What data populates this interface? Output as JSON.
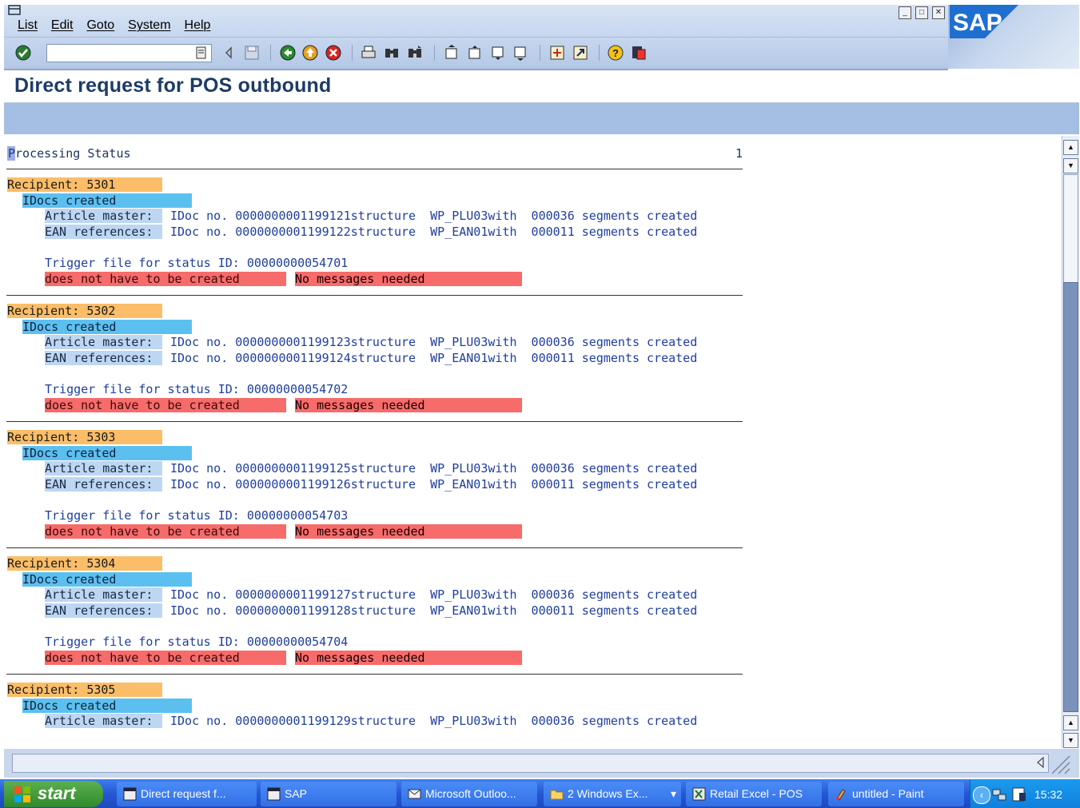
{
  "menu": {
    "items": [
      "List",
      "Edit",
      "Goto",
      "System",
      "Help"
    ]
  },
  "brand": "SAP",
  "command_field": {
    "value": ""
  },
  "title": "Direct request for POS outbound",
  "report": {
    "header": "Processing Status",
    "page": "1",
    "recipients": [
      {
        "label": "Recipient: 5301",
        "idocs": "IDocs created",
        "lines": [
          {
            "label": "Article master:",
            "text": "IDoc no. 0000000001199121structure  WP_PLU03with  000036 segments created"
          },
          {
            "label": "EAN references:",
            "text": "IDoc no. 0000000001199122structure  WP_EAN01with  000011 segments created"
          }
        ],
        "trigger": "Trigger file for status ID: 00000000054701",
        "status1": "does not have to be created",
        "status2": "No messages needed"
      },
      {
        "label": "Recipient: 5302",
        "idocs": "IDocs created",
        "lines": [
          {
            "label": "Article master:",
            "text": "IDoc no. 0000000001199123structure  WP_PLU03with  000036 segments created"
          },
          {
            "label": "EAN references:",
            "text": "IDoc no. 0000000001199124structure  WP_EAN01with  000011 segments created"
          }
        ],
        "trigger": "Trigger file for status ID: 00000000054702",
        "status1": "does not have to be created",
        "status2": "No messages needed"
      },
      {
        "label": "Recipient: 5303",
        "idocs": "IDocs created",
        "lines": [
          {
            "label": "Article master:",
            "text": "IDoc no. 0000000001199125structure  WP_PLU03with  000036 segments created"
          },
          {
            "label": "EAN references:",
            "text": "IDoc no. 0000000001199126structure  WP_EAN01with  000011 segments created"
          }
        ],
        "trigger": "Trigger file for status ID: 00000000054703",
        "status1": "does not have to be created",
        "status2": "No messages needed"
      },
      {
        "label": "Recipient: 5304",
        "idocs": "IDocs created",
        "lines": [
          {
            "label": "Article master:",
            "text": "IDoc no. 0000000001199127structure  WP_PLU03with  000036 segments created"
          },
          {
            "label": "EAN references:",
            "text": "IDoc no. 0000000001199128structure  WP_EAN01with  000011 segments created"
          }
        ],
        "trigger": "Trigger file for status ID: 00000000054704",
        "status1": "does not have to be created",
        "status2": "No messages needed"
      },
      {
        "label": "Recipient: 5305",
        "idocs": "IDocs created",
        "lines": [
          {
            "label": "Article master:",
            "text": "IDoc no. 0000000001199129structure  WP_PLU03with  000036 segments created"
          }
        ]
      }
    ]
  },
  "taskbar": {
    "start": "start",
    "tasks": [
      "Direct request f...",
      "SAP",
      "Microsoft Outloo...",
      "2 Windows Ex...",
      "Retail Excel - POS",
      "untitled - Paint"
    ],
    "clock": "15:32"
  },
  "icons": [
    "menu-icon",
    "enter-icon",
    "save-icon",
    "back-icon",
    "exit-icon",
    "cancel-icon",
    "print-icon",
    "find-icon",
    "find-next-icon",
    "first-page-icon",
    "previous-page-icon",
    "next-page-icon",
    "last-page-icon",
    "create-session-icon",
    "shortcut-icon",
    "help-icon",
    "layout-icon"
  ]
}
